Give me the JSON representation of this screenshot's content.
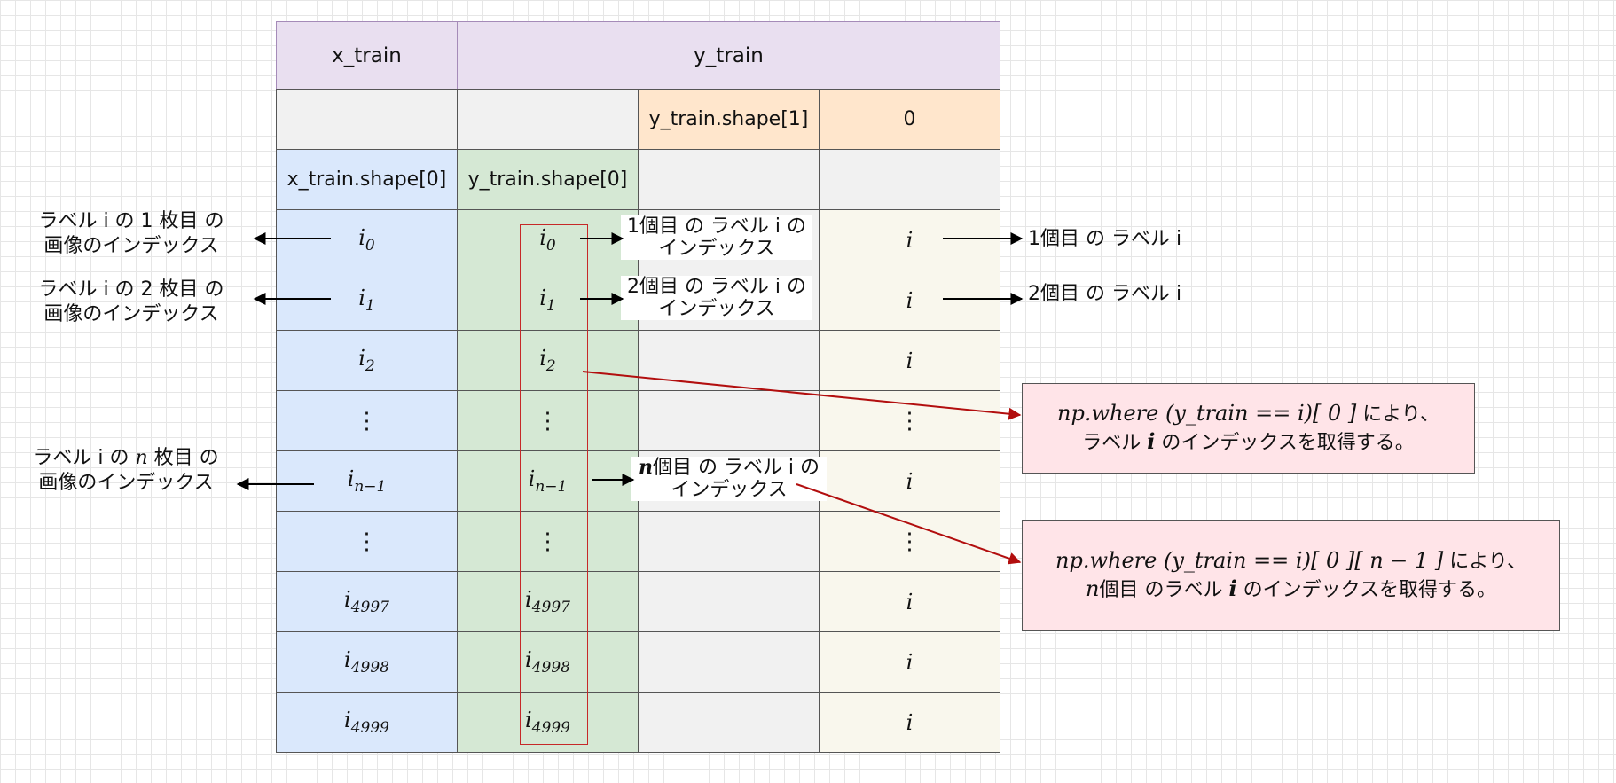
{
  "table": {
    "header_x": "x_train",
    "header_y": "y_train",
    "y_shape1": "y_train.shape[1]",
    "zero": "0",
    "x_shape0": "x_train.shape[0]",
    "y_shape0": "y_train.shape[0]",
    "rows": [
      {
        "base": "i",
        "sub": "0"
      },
      {
        "base": "i",
        "sub": "1"
      },
      {
        "base": "i",
        "sub": "2"
      },
      {
        "base": "⋮",
        "sub": ""
      },
      {
        "base": "i",
        "sub": "n−1"
      },
      {
        "base": "⋮",
        "sub": ""
      },
      {
        "base": "i",
        "sub": "4997"
      },
      {
        "base": "i",
        "sub": "4998"
      },
      {
        "base": "i",
        "sub": "4999"
      }
    ],
    "label_col": [
      "i",
      "i",
      "i",
      "⋮",
      "i",
      "⋮",
      "i",
      "i",
      "i"
    ]
  },
  "left_labels": {
    "l1_line1": "ラベル i の 1 枚目 の",
    "l1_line2": "画像のインデックス",
    "l2_line1": "ラベル i の 2 枚目 の",
    "l2_line2": "画像のインデックス",
    "ln_pre": "ラベル i の ",
    "ln_var": "n",
    "ln_post": " 枚目 の",
    "ln_line2": "画像のインデックス"
  },
  "mid_labels": {
    "m1_line1": "1個目 の ラベル i の",
    "m1_line2": "インデックス",
    "m2_line1": "2個目 の ラベル i の",
    "m2_line2": "インデックス",
    "mn_var": "n",
    "mn_post": "個目 の ラベル i の",
    "mn_line2": "インデックス"
  },
  "right_labels": {
    "r1": "1個目 の ラベル i",
    "r2": "2個目 の ラベル i"
  },
  "note1": {
    "code": "np.where (y_train == i)[ 0 ]",
    "suffix": "  により、",
    "line2_pre": "ラベル ",
    "line2_var": "i",
    "line2_post": " のインデックスを取得する。"
  },
  "note2": {
    "code": "np.where (y_train == i)[ 0 ][ n − 1 ]",
    "suffix": "  により、",
    "line2_var_n": "n",
    "line2_mid": "個目 のラベル ",
    "line2_var_i": "i",
    "line2_post": " のインデックスを取得する。"
  },
  "colors": {
    "arrow_black": "#000000",
    "arrow_red": "#b20e0e",
    "highlight_box": "#c62828"
  }
}
